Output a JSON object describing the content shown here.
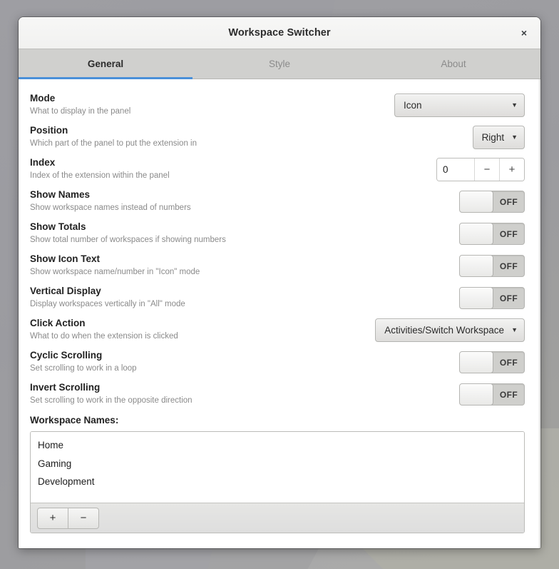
{
  "window": {
    "title": "Workspace Switcher",
    "close_label": "×"
  },
  "tabs": [
    {
      "label": "General",
      "active": true
    },
    {
      "label": "Style",
      "active": false
    },
    {
      "label": "About",
      "active": false
    }
  ],
  "settings": [
    {
      "name": "Mode",
      "description": "What to display in the panel",
      "control": "combo",
      "value": "Icon"
    },
    {
      "name": "Position",
      "description": "Which part of the panel to put the extension in",
      "control": "combo",
      "value": "Right"
    },
    {
      "name": "Index",
      "description": "Index of the extension within the panel",
      "control": "spin",
      "value": "0",
      "decrement_label": "−",
      "increment_label": "+"
    },
    {
      "name": "Show Names",
      "description": "Show workspace names instead of numbers",
      "control": "switch",
      "value": "OFF"
    },
    {
      "name": "Show Totals",
      "description": "Show total number of workspaces if showing numbers",
      "control": "switch",
      "value": "OFF"
    },
    {
      "name": "Show Icon Text",
      "description": "Show workspace name/number in \"Icon\" mode",
      "control": "switch",
      "value": "OFF"
    },
    {
      "name": "Vertical Display",
      "description": "Display workspaces vertically in \"All\" mode",
      "control": "switch",
      "value": "OFF"
    },
    {
      "name": "Click Action",
      "description": "What to do when the extension is clicked",
      "control": "combo",
      "value": "Activities/Switch Workspace"
    },
    {
      "name": "Cyclic Scrolling",
      "description": "Set scrolling to work in a loop",
      "control": "switch",
      "value": "OFF"
    },
    {
      "name": "Invert Scrolling",
      "description": "Set scrolling to work in the opposite direction",
      "control": "switch",
      "value": "OFF"
    }
  ],
  "workspace_names": {
    "label": "Workspace Names:",
    "items": [
      "Home",
      "Gaming",
      "Development"
    ],
    "add_label": "+",
    "remove_label": "−"
  },
  "colors": {
    "accent": "#4a90d9",
    "titlebar": "#f5f5f4",
    "tabbar": "#d0d0ce",
    "content": "#ffffff",
    "text": "#222222",
    "muted_text": "#8a8a8a"
  }
}
